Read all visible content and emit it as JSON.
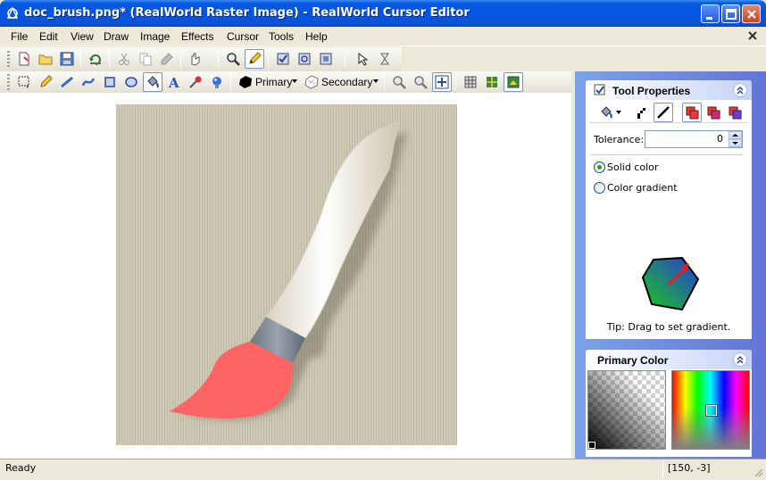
{
  "window": {
    "title": "doc_brush.png* (RealWorld Raster Image) - RealWorld Cursor Editor"
  },
  "menu": [
    {
      "label": "File"
    },
    {
      "label": "Edit"
    },
    {
      "label": "View"
    },
    {
      "label": "Draw"
    },
    {
      "label": "Image"
    },
    {
      "label": "Effects"
    },
    {
      "label": "Cursor"
    },
    {
      "label": "Tools"
    },
    {
      "label": "Help"
    }
  ],
  "draw_toolbar": {
    "primary_label": "Primary",
    "secondary_label": "Secondary"
  },
  "tool_properties": {
    "title": "Tool Properties",
    "tolerance_label": "Tolerance:",
    "tolerance_value": "0",
    "option_solid": "Solid color",
    "option_gradient": "Color gradient",
    "selected_option": "solid",
    "tip": "Tip: Drag to set gradient."
  },
  "primary_color": {
    "title": "Primary Color"
  },
  "status": {
    "text": "Ready",
    "coords": "[150, -3]"
  },
  "colors": {
    "titlebar": "#0454e3",
    "brush_tip": "#ff6464",
    "ferrule": "#7a8592",
    "panel_bg": "#6f8ddd"
  }
}
